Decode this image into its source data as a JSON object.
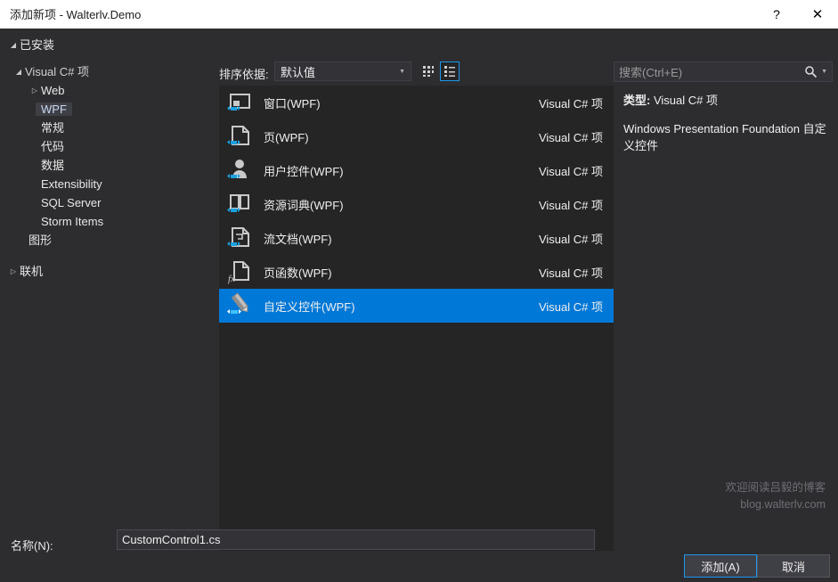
{
  "window": {
    "title": "添加新项 - Walterlv.Demo",
    "help_label": "?",
    "close_label": "✕"
  },
  "toolbar": {
    "sort_label": "排序依据:",
    "sort_value": "默认值",
    "grid_view_icon": "grid-view-icon",
    "list_view_icon": "list-view-icon"
  },
  "search": {
    "placeholder": "搜索(Ctrl+E)",
    "icon": "search-icon"
  },
  "sidebar": {
    "items": [
      {
        "label": "已安装",
        "level": 0,
        "state": "expanded"
      },
      {
        "label": "Visual C# 项",
        "level": 1,
        "state": "expanded"
      },
      {
        "label": "Web",
        "level": 2,
        "state": "collapsed"
      },
      {
        "label": "WPF",
        "level": 2,
        "state": "selected"
      },
      {
        "label": "常规",
        "level": 2,
        "state": "none"
      },
      {
        "label": "代码",
        "level": 2,
        "state": "none"
      },
      {
        "label": "数据",
        "level": 2,
        "state": "none"
      },
      {
        "label": "Extensibility",
        "level": 2,
        "state": "none"
      },
      {
        "label": "SQL Server",
        "level": 2,
        "state": "none"
      },
      {
        "label": "Storm Items",
        "level": 2,
        "state": "none"
      },
      {
        "label": "图形",
        "level": 1,
        "state": "none"
      },
      {
        "label": "联机",
        "level": 0,
        "state": "collapsed"
      }
    ]
  },
  "list": {
    "items": [
      {
        "name": "窗口(WPF)",
        "type": "Visual C# 项",
        "icon": "window-icon",
        "selected": false
      },
      {
        "name": "页(WPF)",
        "type": "Visual C# 项",
        "icon": "page-icon",
        "selected": false
      },
      {
        "name": "用户控件(WPF)",
        "type": "Visual C# 项",
        "icon": "user-control-icon",
        "selected": false
      },
      {
        "name": "资源词典(WPF)",
        "type": "Visual C# 项",
        "icon": "resource-dictionary-icon",
        "selected": false
      },
      {
        "name": "流文档(WPF)",
        "type": "Visual C# 项",
        "icon": "flow-document-icon",
        "selected": false
      },
      {
        "name": "页函数(WPF)",
        "type": "Visual C# 项",
        "icon": "page-function-icon",
        "selected": false
      },
      {
        "name": "自定义控件(WPF)",
        "type": "Visual C# 项",
        "icon": "custom-control-icon",
        "selected": true
      }
    ]
  },
  "detail": {
    "type_label": "类型:",
    "type_value": "Visual C# 项",
    "description": "Windows Presentation Foundation 自定义控件"
  },
  "watermark": {
    "line1": "欢迎阅读吕毅的博客",
    "line2": "blog.walterlv.com"
  },
  "footer": {
    "name_label": "名称(N):",
    "name_value": "CustomControl1.cs",
    "add_label": "添加(A)",
    "cancel_label": "取消"
  },
  "colors": {
    "accent": "#0078D7",
    "focus_border": "#1C97EA",
    "dialog_bg": "#2D2D30",
    "list_bg": "#252526",
    "titlebar_bg": "#FFFFFF"
  }
}
